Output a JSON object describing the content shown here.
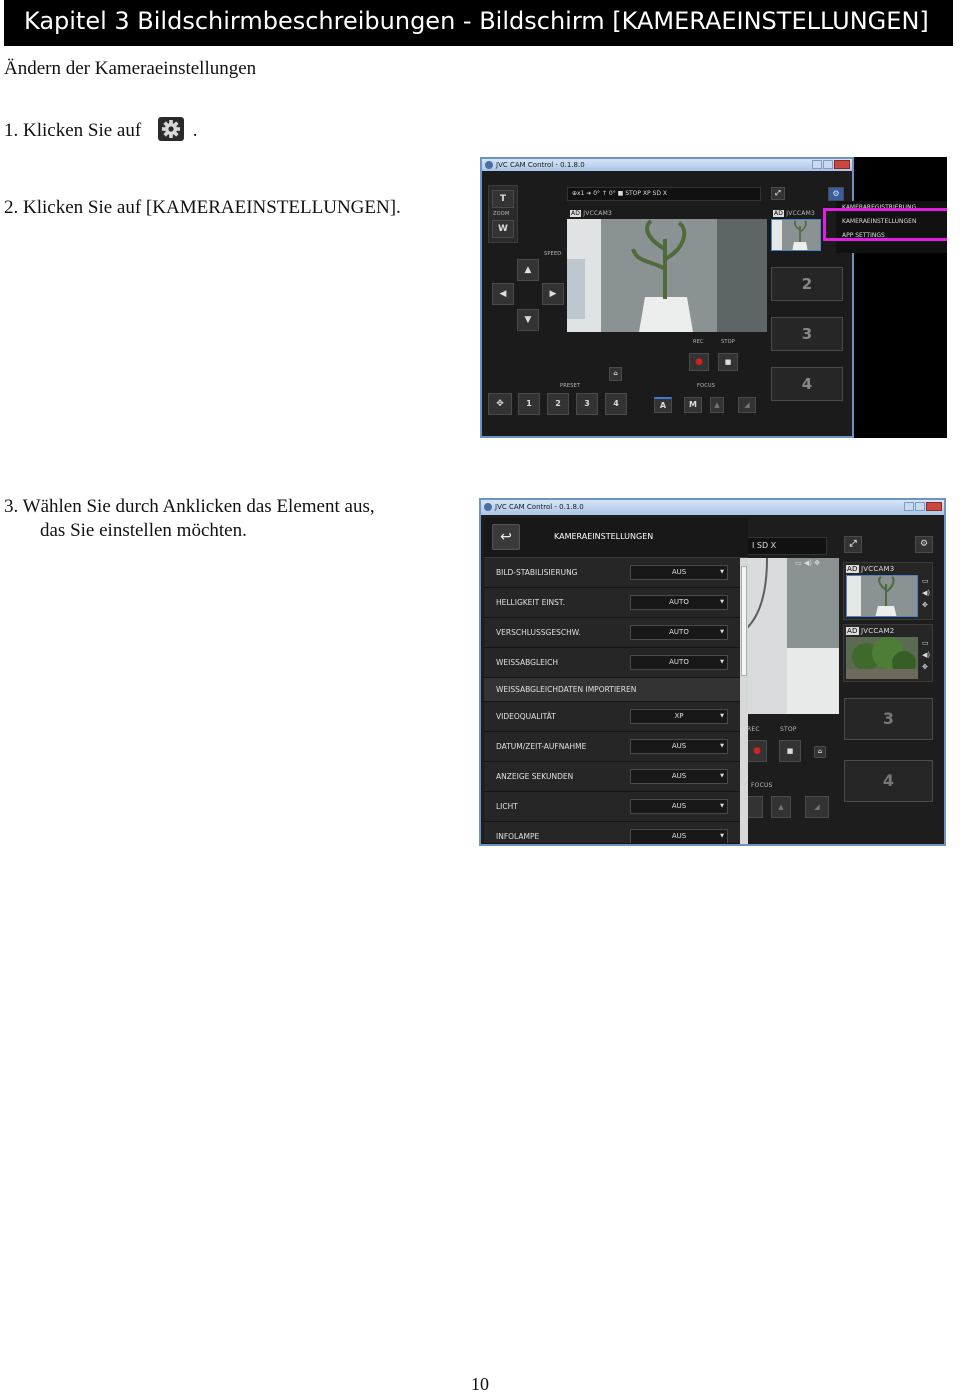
{
  "header": {
    "title": "Kapitel 3  Bildschirmbeschreibungen - Bildschirm [KAMERAEINSTELLUNGEN]"
  },
  "subtitle": "Ändern der Kameraeinstellungen",
  "steps": {
    "s1_pre": "1.  Klicken Sie auf",
    "s1_post": ".",
    "s2": "2.  Klicken Sie auf [KAMERAEINSTELLUNGEN].",
    "s3_line1": "3.  Wählen Sie durch Anklicken das Element aus,",
    "s3_line2": "das Sie einstellen    möchten."
  },
  "page_number": "10",
  "screenshot1": {
    "title": "JVC CAM Control - 0.1.8.0",
    "zoom_t": "T",
    "zoom_label": "ZOOM",
    "zoom_w": "W",
    "speed": "SPEED",
    "status_text": "⊕x1   ➔   0°   ↑   0°   ■ STOP   XP  SD X",
    "cam_label": "JVCCAM3",
    "side_cam_label": "JVCCAM3",
    "ad_badge": "AD",
    "rec": "REC",
    "stop": "STOP",
    "preset": "PRESET",
    "focus": "FOCUS",
    "preset_buttons": [
      "1",
      "2",
      "3",
      "4"
    ],
    "focus_a": "A",
    "focus_m": "M",
    "slots": [
      "2",
      "3",
      "4"
    ],
    "menu": [
      "KAMERAREGISTRIERUNG",
      "KAMERAEINSTELLUNGEN",
      "APP SETTINGS"
    ]
  },
  "screenshot2": {
    "title": "JVC CAM Control - 0.1.8.0",
    "panel_title": "KAMERAEINSTELLUNGEN",
    "back": "↩",
    "status_text": "I SD X",
    "rows": [
      {
        "label": "BILD-STABILISIERUNG",
        "value": "AUS"
      },
      {
        "label": "HELLIGKEIT EINST.",
        "value": "AUTO"
      },
      {
        "label": "VERSCHLUSSGESCHW.",
        "value": "AUTO"
      },
      {
        "label": "WEISSABGLEICH",
        "value": "AUTO"
      },
      {
        "label": "WEISSABGLEICHDATEN IMPORTIEREN",
        "value": ""
      },
      {
        "label": "VIDEOQUALITÄT",
        "value": "XP"
      },
      {
        "label": "DATUM/ZEIT-AUFNAHME",
        "value": "AUS"
      },
      {
        "label": "ANZEIGE SEKUNDEN",
        "value": "AUS"
      },
      {
        "label": "LICHT",
        "value": "AUS"
      },
      {
        "label": "INFOLAMPE",
        "value": "AUS"
      }
    ],
    "side_cams": [
      "JVCCAM3",
      "JVCCAM2"
    ],
    "ad_badge": "AD",
    "rec": "REC",
    "stop": "STOP",
    "focus": "FOCUS",
    "slots": [
      "3",
      "4"
    ]
  }
}
